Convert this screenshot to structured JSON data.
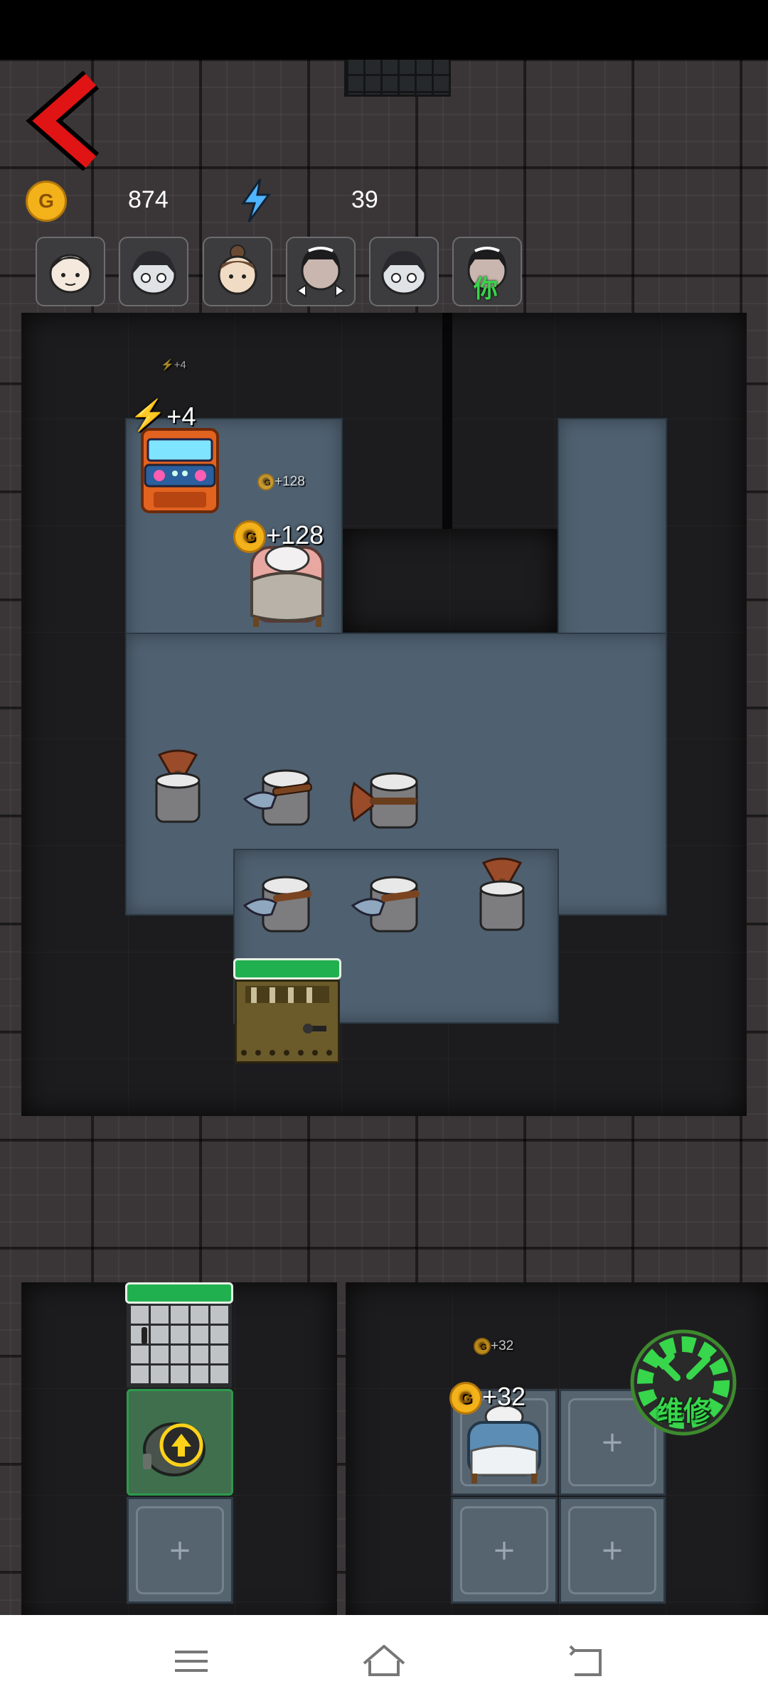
{
  "resources": {
    "gold_icon": "G",
    "gold": "874",
    "energy_icon": "lightning-bolt",
    "energy": "39"
  },
  "avatars": [
    {
      "name": "girl-bangs-avatar"
    },
    {
      "name": "pale-ghost-avatar"
    },
    {
      "name": "bun-hair-avatar"
    },
    {
      "name": "maid-bow-avatar"
    },
    {
      "name": "pale-ghost-avatar-2"
    },
    {
      "name": "maid-you-avatar",
      "tag": "你"
    }
  ],
  "floats": {
    "energy_small": "+4",
    "energy_big": "+4",
    "gold_small_top": "+128",
    "gold_big_top": "+128",
    "gold_small_bottom": "+32",
    "gold_big_bottom": "+32",
    "coin_letter": "G"
  },
  "repair_button": {
    "label": "维修"
  },
  "slot_plus": "+",
  "colors": {
    "accent_green": "#37d64b",
    "back_red": "#e01414",
    "hp_green": "#21b04f"
  }
}
